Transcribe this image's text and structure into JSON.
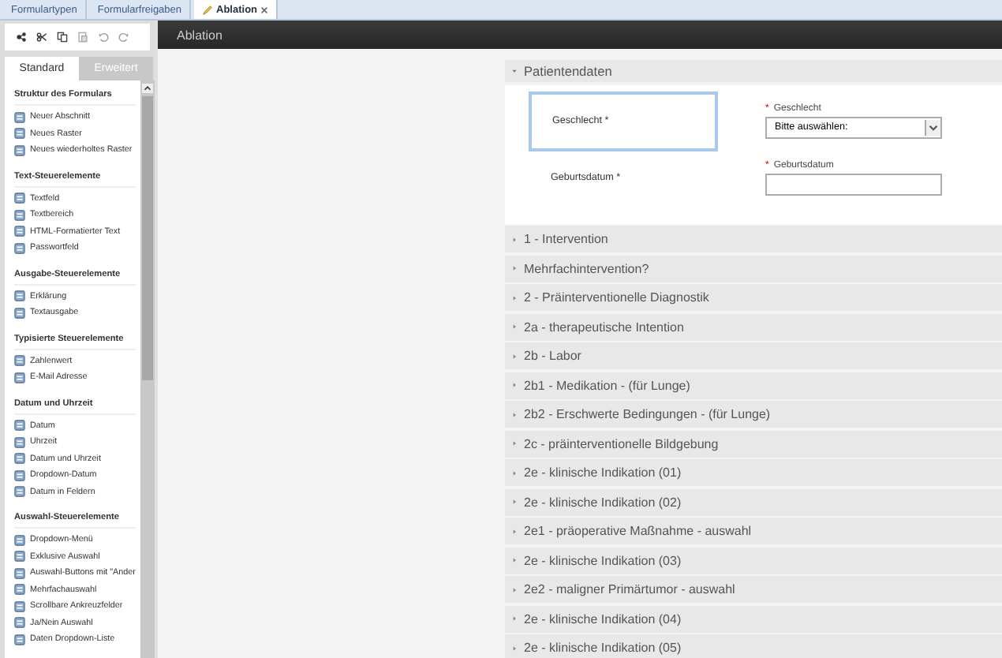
{
  "doc_tabs": [
    {
      "label": "Formulartypen",
      "selected": false
    },
    {
      "label": "Formularfreigaben",
      "selected": false
    },
    {
      "label": "Ablation",
      "selected": true
    }
  ],
  "palette_tabs": [
    {
      "label": "Standard",
      "selected": true
    },
    {
      "label": "Erweitert",
      "selected": false
    }
  ],
  "palette": [
    {
      "title": "Struktur des Formulars",
      "items": [
        "Neuer Abschnitt",
        "Neues Raster",
        "Neues wiederholtes Raster"
      ]
    },
    {
      "title": "Text-Steuerelemente",
      "items": [
        "Textfeld",
        "Textbereich",
        "HTML-Formatierter Text",
        "Passwortfeld"
      ]
    },
    {
      "title": "Ausgabe-Steuerelemente",
      "items": [
        "Erklärung",
        "Textausgabe"
      ]
    },
    {
      "title": "Typisierte Steuerelemente",
      "items": [
        "Zahlenwert",
        "E-Mail Adresse"
      ]
    },
    {
      "title": "Datum und Uhrzeit",
      "items": [
        "Datum",
        "Uhrzeit",
        "Datum und Uhrzeit",
        "Dropdown-Datum",
        "Datum in Feldern"
      ]
    },
    {
      "title": "Auswahl-Steuerelemente",
      "items": [
        "Dropdown-Menü",
        "Exklusive Auswahl",
        "Auswahl-Buttons mit \"Ander",
        "Mehrfachauswahl",
        "Scrollbare Ankreuzfelder",
        "Ja/Nein Auswahl",
        "Daten Dropdown-Liste"
      ]
    }
  ],
  "form_title": "Ablation",
  "open_section": {
    "title": "Patientendaten",
    "expanded": true,
    "fields": [
      {
        "kind": "select",
        "caption": "Geschlecht *",
        "label": "Geschlecht",
        "required_mark": "*",
        "value": "Bitte auswählen:",
        "selected": true
      },
      {
        "kind": "text",
        "caption": "Geburtsdatum *",
        "label": "Geburtsdatum",
        "required_mark": "*",
        "selected": false
      }
    ]
  },
  "sections": [
    {
      "title": "1 - Intervention",
      "expanded": false
    },
    {
      "title": "Mehrfachintervention?",
      "expanded": false
    },
    {
      "title": "2 - Präinterventionelle Diagnostik",
      "expanded": false
    },
    {
      "title": "2a - therapeutische Intention",
      "expanded": false
    },
    {
      "title": "2b - Labor",
      "expanded": false
    },
    {
      "title": "2b1 - Medikation - (für Lunge)",
      "expanded": false
    },
    {
      "title": "2b2 - Erschwerte Bedingungen - (für Lunge)",
      "expanded": false
    },
    {
      "title": "2c - präinterventionelle Bildgebung",
      "expanded": false
    },
    {
      "title": "2e - klinische Indikation (01)",
      "expanded": false
    },
    {
      "title": "2e - klinische Indikation (02)",
      "expanded": false
    },
    {
      "title": "2e1 - präoperative Maßnahme - auswahl",
      "expanded": false
    },
    {
      "title": "2e - klinische Indikation (03)",
      "expanded": false
    },
    {
      "title": "2e2 - maligner Primärtumor - auswahl",
      "expanded": false
    },
    {
      "title": "2e - klinische Indikation (04)",
      "expanded": false
    },
    {
      "title": "2e - klinische Indikation (05)",
      "expanded": false
    }
  ]
}
